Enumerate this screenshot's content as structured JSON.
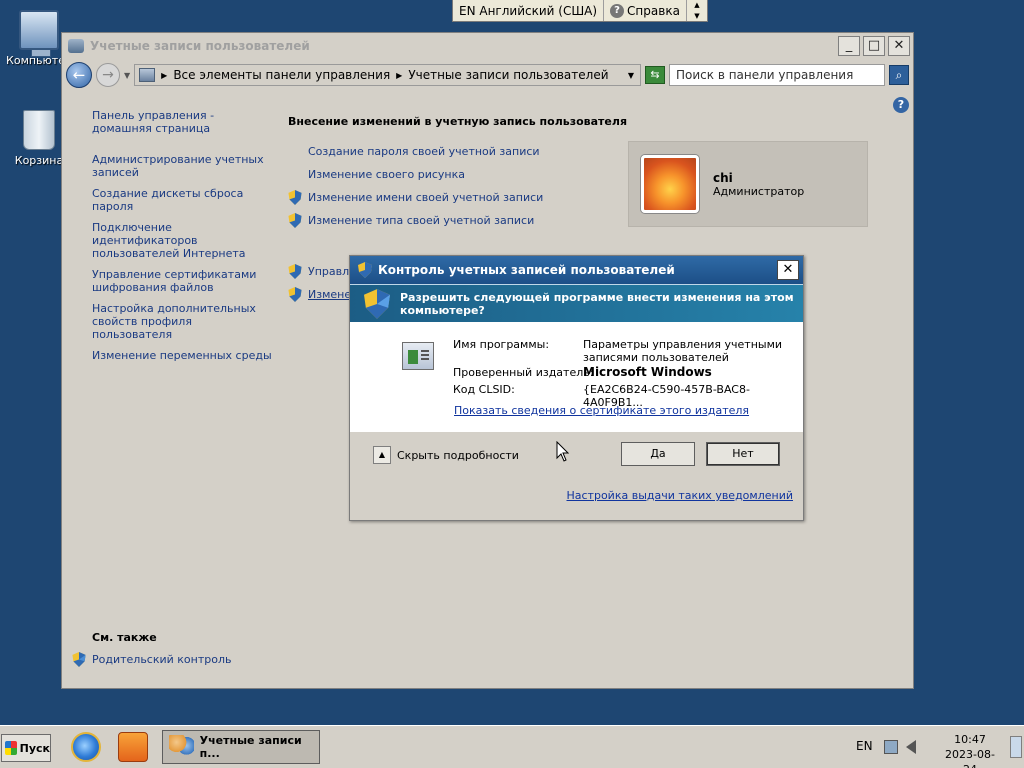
{
  "desktop": {
    "icons": [
      {
        "label": "Компьютер"
      },
      {
        "label": "Корзина"
      }
    ]
  },
  "langbar": {
    "language": "EN Английский (США)",
    "help": "Справка"
  },
  "window": {
    "title": "Учетные записи пользователей",
    "min": "_",
    "max": "□",
    "close": "✕",
    "breadcrumb": [
      "Все элементы панели управления",
      "Учетные записи пользователей"
    ],
    "search_placeholder": "Поиск в панели управления",
    "sidebar": [
      "Панель управления - домашняя страница",
      "Администрирование учетных записей",
      "Создание дискеты сброса пароля",
      "Подключение идентификаторов пользователей Интернета",
      "Управление сертификатами шифрования файлов",
      "Настройка дополнительных свойств профиля пользователя",
      "Изменение переменных среды"
    ],
    "see_also_title": "См. также",
    "see_also_link": "Родительский контроль",
    "content_heading": "Внесение изменений в учетную запись пользователя",
    "tasks": [
      {
        "label": "Создание пароля своей учетной записи",
        "shield": false
      },
      {
        "label": "Изменение своего рисунка",
        "shield": false
      },
      {
        "label": "Изменение имени своей учетной записи",
        "shield": true
      },
      {
        "label": "Изменение типа своей учетной записи",
        "shield": true
      }
    ],
    "hidden_tasks": [
      {
        "label": "Управле",
        "shield": true
      },
      {
        "label": "Изменен",
        "shield": true
      }
    ],
    "user": {
      "name": "chi",
      "role": "Администратор"
    }
  },
  "uac": {
    "title": "Контроль учетных записей пользователей",
    "close": "✕",
    "question": "Разрешить следующей программе внести изменения на этом компьютере?",
    "program_label": "Имя программы:",
    "program_value": "Параметры управления учетными записями пользователей",
    "publisher_label": "Проверенный издатель:",
    "publisher_value": "Microsoft Windows",
    "clsid_label": "Код CLSID:",
    "clsid_value": "{EA2C6B24-C590-457B-BAC8-4A0F9B1...",
    "cert_link": "Показать сведения о сертификате этого издателя",
    "toggle_details": "Скрыть подробности",
    "yes": "Да",
    "no": "Нет",
    "notify_link": "Настройка выдачи таких уведомлений"
  },
  "taskbar": {
    "start": "Пуск",
    "task_button": "Учетные записи п...",
    "lang": "EN",
    "time": "10:47",
    "date": "2023-08-24"
  },
  "colors": {
    "desktop": "#1e4672",
    "link": "#1a3a82",
    "uac_banner": "#1c5d85"
  }
}
